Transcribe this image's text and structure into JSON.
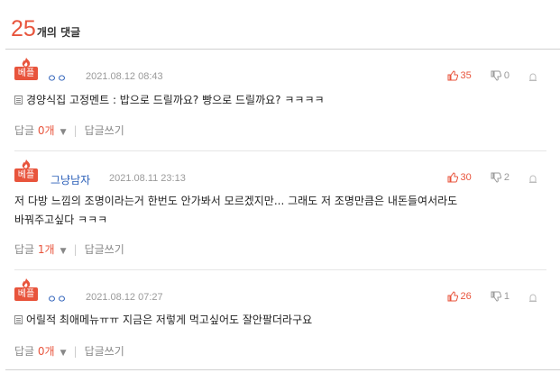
{
  "header": {
    "count": "25",
    "label": "개의 댓글"
  },
  "comments": [
    {
      "badge": "베플",
      "author": "ㅇㅇ",
      "date": "2021.08.12 08:43",
      "likes": "35",
      "dislikes": "0",
      "has_doc_icon": true,
      "lines": [
        "경양식집 고정멘트 : 밥으로 드릴까요? 빵으로 드릴까요? ㅋㅋㅋㅋ"
      ],
      "reply_label": "답글",
      "reply_count": "0개",
      "write_label": "답글쓰기"
    },
    {
      "badge": "베플",
      "author": "그냥남자",
      "date": "2021.08.11 23:13",
      "likes": "30",
      "dislikes": "2",
      "has_doc_icon": false,
      "lines": [
        "저 다방 느낌의 조명이라는거 한번도 안가봐서 모르겠지만... 그래도 저 조명만큼은 내돈들여서라도",
        "바꿔주고싶다 ㅋㅋㅋ"
      ],
      "reply_label": "답글",
      "reply_count": "1개",
      "write_label": "답글쓰기"
    },
    {
      "badge": "베플",
      "author": "ㅇㅇ",
      "date": "2021.08.12 07:27",
      "likes": "26",
      "dislikes": "1",
      "has_doc_icon": true,
      "lines": [
        "어릴적 최애메뉴ㅠㅠ 지금은 저렇게 먹고싶어도 잘안팔더라구요"
      ],
      "reply_label": "답글",
      "reply_count": "0개",
      "write_label": "답글쓰기"
    }
  ],
  "colors": {
    "accent": "#e8543c",
    "author": "#2b5fb8"
  },
  "icons": {
    "like": "thumbs-up-icon",
    "dislike": "thumbs-down-icon",
    "report": "siren-icon",
    "badge": "best-reply-flame-icon"
  }
}
